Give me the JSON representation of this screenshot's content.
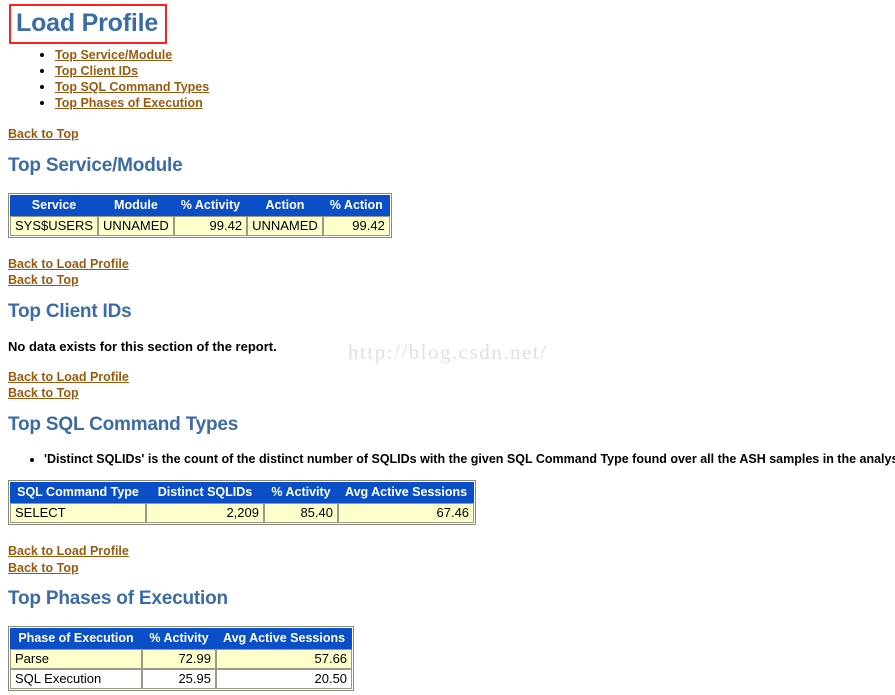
{
  "watermark": "http://blog.csdn.net/",
  "page": {
    "main_title": "Load Profile"
  },
  "toc": {
    "items": [
      {
        "label": "Top Service/Module"
      },
      {
        "label": "Top Client IDs"
      },
      {
        "label": "Top SQL Command Types"
      },
      {
        "label": "Top Phases of Execution"
      }
    ]
  },
  "links": {
    "back_to_top": "Back to Top",
    "back_to_load_profile": "Back to Load Profile"
  },
  "sections": {
    "service_module": {
      "title": "Top Service/Module",
      "table": {
        "headers": [
          "Service",
          "Module",
          "% Activity",
          "Action",
          "% Action"
        ],
        "rows": [
          {
            "cells": [
              "SYS$USERS",
              "UNNAMED",
              "99.42",
              "UNNAMED",
              "99.42"
            ],
            "align": [
              "txt",
              "txt",
              "num",
              "txt",
              "num"
            ],
            "fill": "rowfill"
          }
        ]
      }
    },
    "client_ids": {
      "title": "Top Client IDs",
      "empty_message": "No data exists for this section of the report."
    },
    "sql_command_types": {
      "title": "Top SQL Command Types",
      "note": "'Distinct SQLIDs' is the count of the distinct number of SQLIDs with the given SQL Command Type found over all the ASH samples in the analysis period",
      "table": {
        "headers": [
          "SQL Command Type",
          "Distinct SQLIDs",
          "% Activity",
          "Avg Active Sessions"
        ],
        "rows": [
          {
            "cells": [
              "SELECT",
              "2,209",
              "85.40",
              "67.46"
            ],
            "align": [
              "txt",
              "num",
              "num",
              "num"
            ],
            "fill": "rowfill"
          }
        ]
      }
    },
    "phases_of_execution": {
      "title": "Top Phases of Execution",
      "table": {
        "headers": [
          "Phase of Execution",
          "% Activity",
          "Avg Active Sessions"
        ],
        "rows": [
          {
            "cells": [
              "Parse",
              "72.99",
              "57.66"
            ],
            "align": [
              "txt",
              "num",
              "num"
            ],
            "fill": "rowfill"
          },
          {
            "cells": [
              "SQL Execution",
              "25.95",
              "20.50"
            ],
            "align": [
              "txt",
              "num",
              "num"
            ],
            "fill": "rowplain"
          }
        ]
      }
    }
  },
  "colors": {
    "heading": "#3c6ba5",
    "link": "#9a5b10",
    "table_header_bg": "#0a4fc8",
    "table_row_fill": "#ffffcc",
    "annotation": "#fd2020"
  }
}
